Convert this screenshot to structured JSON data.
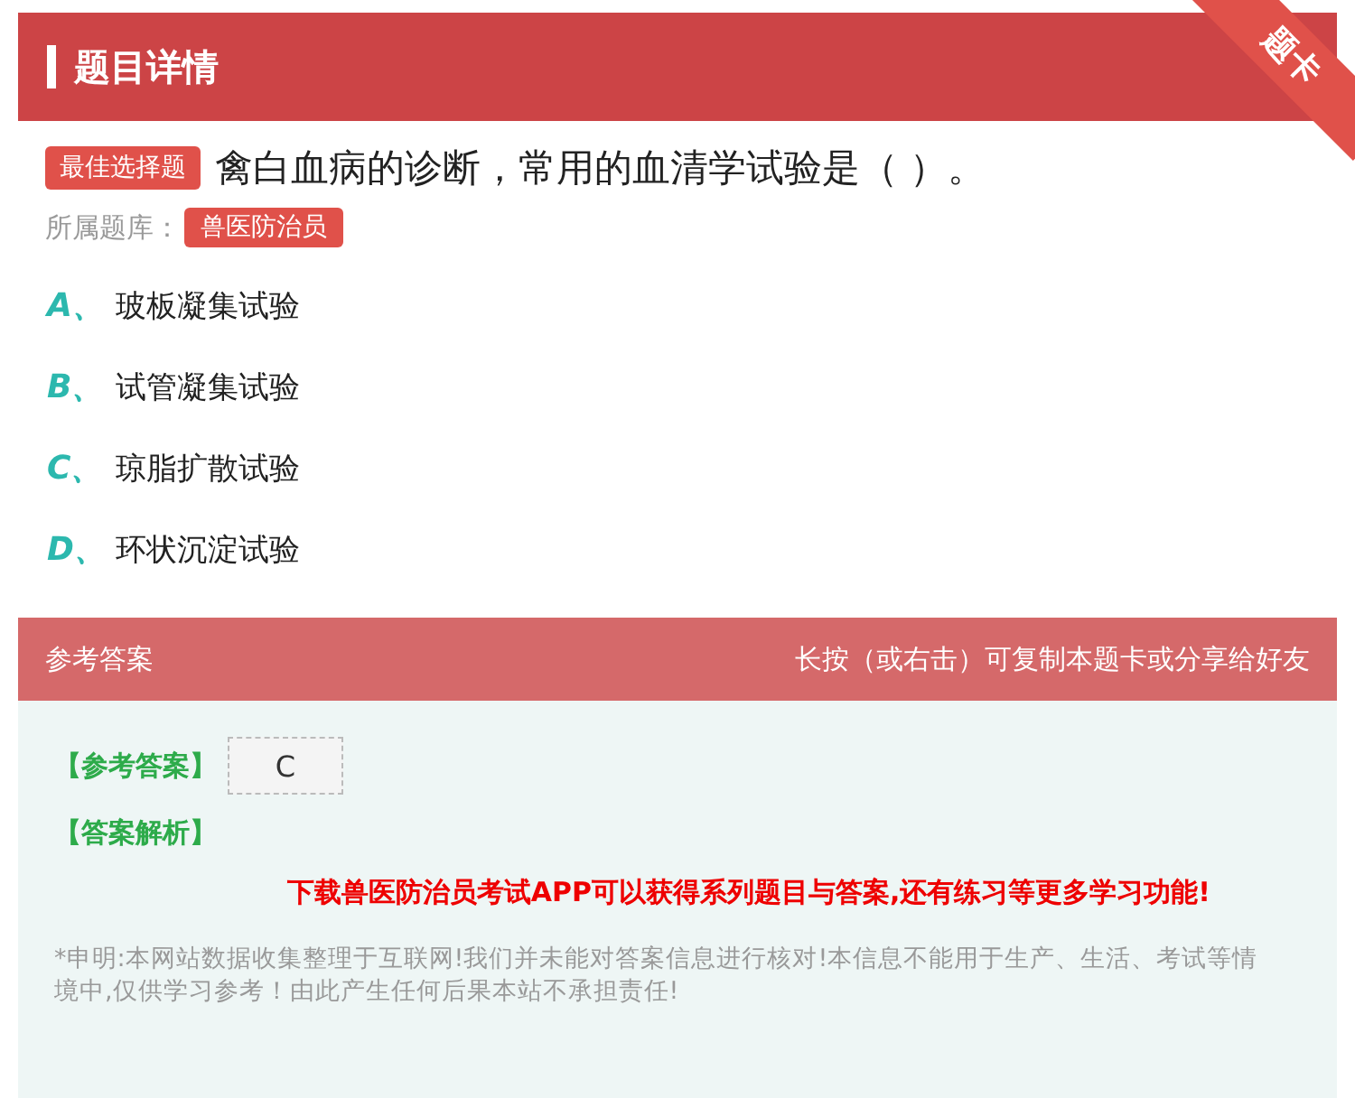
{
  "header": {
    "title": "题目详情",
    "ribbon": "题卡"
  },
  "question": {
    "type_badge": "最佳选择题",
    "text": "禽白血病的诊断，常用的血清学试验是（ ）。",
    "bank_label": "所属题库：",
    "bank": "兽医防治员"
  },
  "options": [
    {
      "letter": "A、",
      "text": "玻板凝集试验"
    },
    {
      "letter": "B、",
      "text": "试管凝集试验"
    },
    {
      "letter": "C、",
      "text": "琼脂扩散试验"
    },
    {
      "letter": "D、",
      "text": "环状沉淀试验"
    }
  ],
  "answer_section": {
    "title": "参考答案",
    "hint": "长按（或右击）可复制本题卡或分享给好友",
    "answer_label": "【参考答案】",
    "answer": "C",
    "analysis_label": "【答案解析】",
    "promo": "下载兽医防治员考试APP可以获得系列题目与答案,还有练习等更多学习功能!",
    "disclaimer": "*申明:本网站数据收集整理于互联网!我们并未能对答案信息进行核对!本信息不能用于生产、生活、考试等情境中,仅供学习参考！由此产生任何后果本站不承担责任!"
  }
}
